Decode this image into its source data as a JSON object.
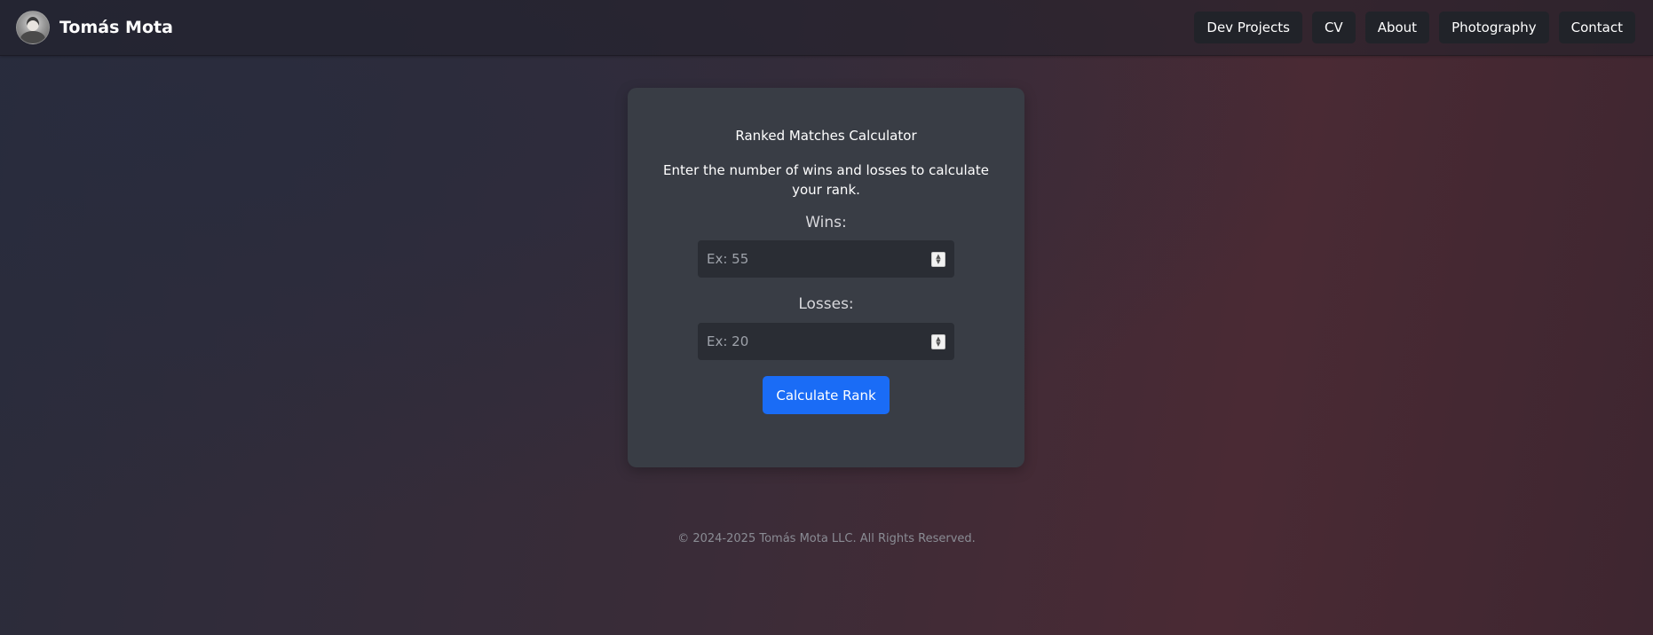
{
  "header": {
    "brand_name": "Tomás Mota",
    "nav": [
      {
        "label": "Dev Projects"
      },
      {
        "label": "CV"
      },
      {
        "label": "About"
      },
      {
        "label": "Photography"
      },
      {
        "label": "Contact"
      }
    ]
  },
  "calculator": {
    "title": "Ranked Matches Calculator",
    "description": "Enter the number of wins and losses to calculate your rank.",
    "wins": {
      "label": "Wins:",
      "placeholder": "Ex: 55",
      "value": ""
    },
    "losses": {
      "label": "Losses:",
      "placeholder": "Ex: 20",
      "value": ""
    },
    "button_label": "Calculate Rank"
  },
  "footer": {
    "text": "© 2024-2025 Tomás Mota LLC. All Rights Reserved."
  },
  "colors": {
    "primary_button": "#1a6cf6",
    "card_background": "#393d45",
    "nav_button_background": "#212329"
  },
  "icons": {
    "avatar": "profile-photo",
    "spinner": "number-stepper-arrows"
  }
}
